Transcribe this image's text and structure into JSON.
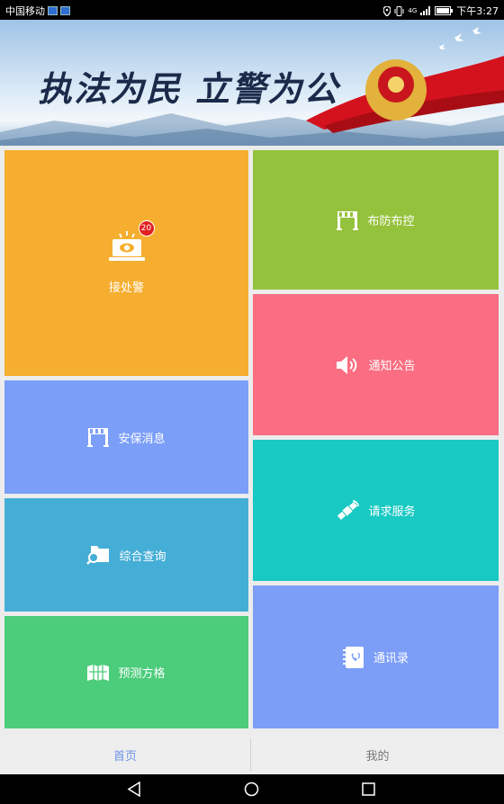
{
  "status_bar": {
    "carrier": "中国移动",
    "signal": "4G",
    "time": "下午3:27"
  },
  "banner": {
    "slogan": "执法为民 立警为公"
  },
  "tiles": [
    {
      "id": "jiechujing",
      "label": "接处警",
      "color": "#f5ae2f",
      "icon": "alarm-laptop-icon",
      "badge": "20"
    },
    {
      "id": "bufangbukong",
      "label": "布防布控",
      "color": "#95c23c",
      "icon": "checkpoint-icon"
    },
    {
      "id": "tongzhigonggao",
      "label": "通知公告",
      "color": "#fb6d81",
      "icon": "speaker-icon"
    },
    {
      "id": "anbaoxiaoxi",
      "label": "安保消息",
      "color": "#7b9ef8",
      "icon": "checkpoint-icon"
    },
    {
      "id": "qingqiufuwu",
      "label": "请求服务",
      "color": "#19c9c3",
      "icon": "satellite-icon"
    },
    {
      "id": "zonghechaxun",
      "label": "综合查询",
      "color": "#45aed6",
      "icon": "folder-search-icon"
    },
    {
      "id": "tongxunlu",
      "label": "通讯录",
      "color": "#7d9ef7",
      "icon": "contacts-book-icon"
    },
    {
      "id": "yucefangge",
      "label": "预测方格",
      "color": "#4ccd7b",
      "icon": "map-icon"
    }
  ],
  "tab_bar": {
    "home": "首页",
    "mine": "我的",
    "active_color": "#6b93e8",
    "inactive_color": "#777777"
  },
  "nav_bar": {
    "back": "back-icon",
    "home": "home-icon",
    "recents": "recents-icon"
  }
}
